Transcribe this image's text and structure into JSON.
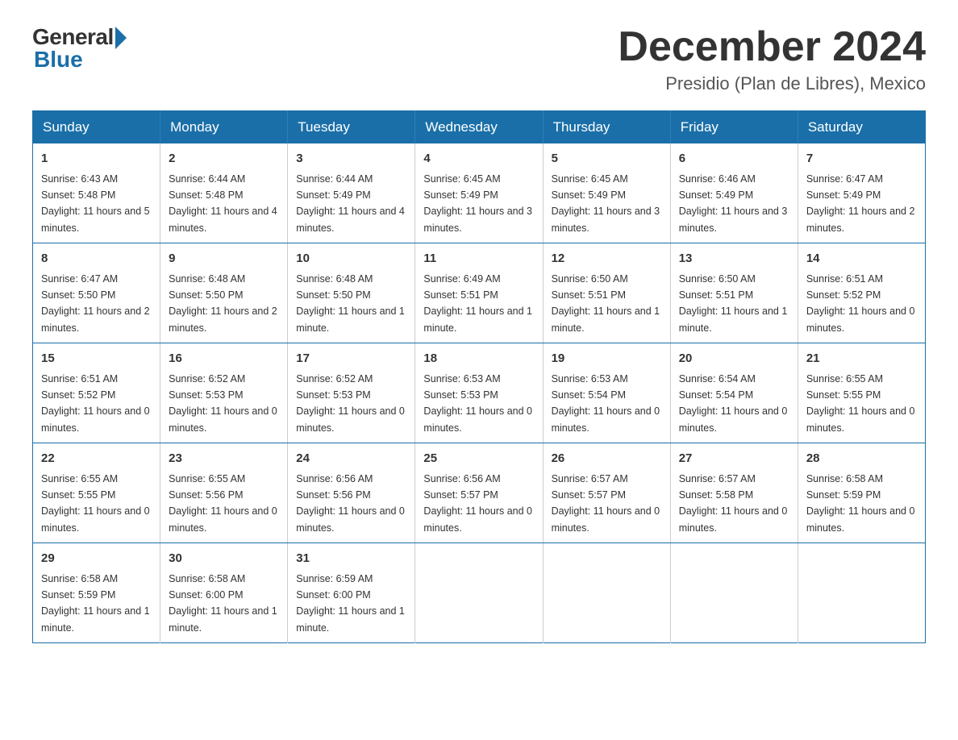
{
  "header": {
    "logo_general": "General",
    "logo_blue": "Blue",
    "month_year": "December 2024",
    "location": "Presidio (Plan de Libres), Mexico"
  },
  "days_of_week": [
    "Sunday",
    "Monday",
    "Tuesday",
    "Wednesday",
    "Thursday",
    "Friday",
    "Saturday"
  ],
  "weeks": [
    [
      {
        "day": "1",
        "sunrise": "6:43 AM",
        "sunset": "5:48 PM",
        "daylight": "11 hours and 5 minutes."
      },
      {
        "day": "2",
        "sunrise": "6:44 AM",
        "sunset": "5:48 PM",
        "daylight": "11 hours and 4 minutes."
      },
      {
        "day": "3",
        "sunrise": "6:44 AM",
        "sunset": "5:49 PM",
        "daylight": "11 hours and 4 minutes."
      },
      {
        "day": "4",
        "sunrise": "6:45 AM",
        "sunset": "5:49 PM",
        "daylight": "11 hours and 3 minutes."
      },
      {
        "day": "5",
        "sunrise": "6:45 AM",
        "sunset": "5:49 PM",
        "daylight": "11 hours and 3 minutes."
      },
      {
        "day": "6",
        "sunrise": "6:46 AM",
        "sunset": "5:49 PM",
        "daylight": "11 hours and 3 minutes."
      },
      {
        "day": "7",
        "sunrise": "6:47 AM",
        "sunset": "5:49 PM",
        "daylight": "11 hours and 2 minutes."
      }
    ],
    [
      {
        "day": "8",
        "sunrise": "6:47 AM",
        "sunset": "5:50 PM",
        "daylight": "11 hours and 2 minutes."
      },
      {
        "day": "9",
        "sunrise": "6:48 AM",
        "sunset": "5:50 PM",
        "daylight": "11 hours and 2 minutes."
      },
      {
        "day": "10",
        "sunrise": "6:48 AM",
        "sunset": "5:50 PM",
        "daylight": "11 hours and 1 minute."
      },
      {
        "day": "11",
        "sunrise": "6:49 AM",
        "sunset": "5:51 PM",
        "daylight": "11 hours and 1 minute."
      },
      {
        "day": "12",
        "sunrise": "6:50 AM",
        "sunset": "5:51 PM",
        "daylight": "11 hours and 1 minute."
      },
      {
        "day": "13",
        "sunrise": "6:50 AM",
        "sunset": "5:51 PM",
        "daylight": "11 hours and 1 minute."
      },
      {
        "day": "14",
        "sunrise": "6:51 AM",
        "sunset": "5:52 PM",
        "daylight": "11 hours and 0 minutes."
      }
    ],
    [
      {
        "day": "15",
        "sunrise": "6:51 AM",
        "sunset": "5:52 PM",
        "daylight": "11 hours and 0 minutes."
      },
      {
        "day": "16",
        "sunrise": "6:52 AM",
        "sunset": "5:53 PM",
        "daylight": "11 hours and 0 minutes."
      },
      {
        "day": "17",
        "sunrise": "6:52 AM",
        "sunset": "5:53 PM",
        "daylight": "11 hours and 0 minutes."
      },
      {
        "day": "18",
        "sunrise": "6:53 AM",
        "sunset": "5:53 PM",
        "daylight": "11 hours and 0 minutes."
      },
      {
        "day": "19",
        "sunrise": "6:53 AM",
        "sunset": "5:54 PM",
        "daylight": "11 hours and 0 minutes."
      },
      {
        "day": "20",
        "sunrise": "6:54 AM",
        "sunset": "5:54 PM",
        "daylight": "11 hours and 0 minutes."
      },
      {
        "day": "21",
        "sunrise": "6:55 AM",
        "sunset": "5:55 PM",
        "daylight": "11 hours and 0 minutes."
      }
    ],
    [
      {
        "day": "22",
        "sunrise": "6:55 AM",
        "sunset": "5:55 PM",
        "daylight": "11 hours and 0 minutes."
      },
      {
        "day": "23",
        "sunrise": "6:55 AM",
        "sunset": "5:56 PM",
        "daylight": "11 hours and 0 minutes."
      },
      {
        "day": "24",
        "sunrise": "6:56 AM",
        "sunset": "5:56 PM",
        "daylight": "11 hours and 0 minutes."
      },
      {
        "day": "25",
        "sunrise": "6:56 AM",
        "sunset": "5:57 PM",
        "daylight": "11 hours and 0 minutes."
      },
      {
        "day": "26",
        "sunrise": "6:57 AM",
        "sunset": "5:57 PM",
        "daylight": "11 hours and 0 minutes."
      },
      {
        "day": "27",
        "sunrise": "6:57 AM",
        "sunset": "5:58 PM",
        "daylight": "11 hours and 0 minutes."
      },
      {
        "day": "28",
        "sunrise": "6:58 AM",
        "sunset": "5:59 PM",
        "daylight": "11 hours and 0 minutes."
      }
    ],
    [
      {
        "day": "29",
        "sunrise": "6:58 AM",
        "sunset": "5:59 PM",
        "daylight": "11 hours and 1 minute."
      },
      {
        "day": "30",
        "sunrise": "6:58 AM",
        "sunset": "6:00 PM",
        "daylight": "11 hours and 1 minute."
      },
      {
        "day": "31",
        "sunrise": "6:59 AM",
        "sunset": "6:00 PM",
        "daylight": "11 hours and 1 minute."
      },
      null,
      null,
      null,
      null
    ]
  ]
}
